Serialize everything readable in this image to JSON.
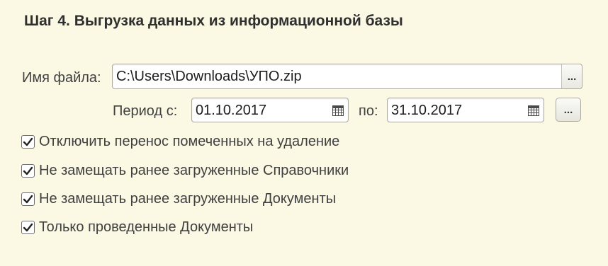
{
  "step_title": "Шаг 4. Выгрузка данных из информационной базы",
  "file": {
    "label": "Имя файла:",
    "value": "C:\\Users\\Downloads\\УПО.zip",
    "select_button": "..."
  },
  "period": {
    "from_label": "Период с:",
    "from_value": "01.10.2017",
    "to_label": "по:",
    "to_value": "31.10.2017",
    "period_button": "..."
  },
  "options": [
    {
      "label": "Отключить перенос помеченных на удаление",
      "checked": true
    },
    {
      "label": "Не замещать ранее загруженные Справочники",
      "checked": true
    },
    {
      "label": "Не замещать ранее загруженные Документы",
      "checked": true
    },
    {
      "label": "Только проведенные Документы",
      "checked": true
    }
  ]
}
